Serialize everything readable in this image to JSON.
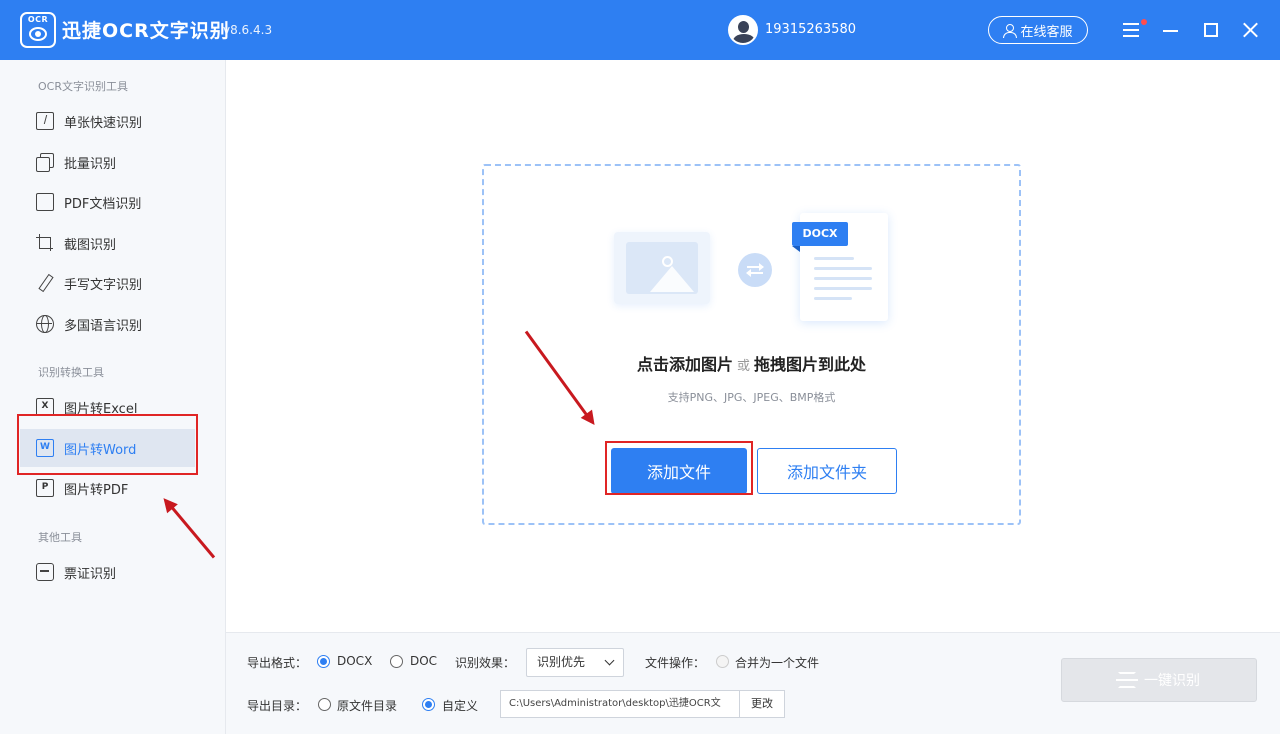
{
  "app": {
    "logo_text": "OCR",
    "name": "迅捷OCR文字识别",
    "version": "v8.6.4.3",
    "phone": "19315263580",
    "service_label": "在线客服"
  },
  "sidebar": {
    "sections": [
      {
        "title": "OCR文字识别工具",
        "items": [
          {
            "label": "单张快速识别",
            "icon": "quick-scan-icon"
          },
          {
            "label": "批量识别",
            "icon": "copy-icon"
          },
          {
            "label": "PDF文档识别",
            "icon": "pdf-doc-icon"
          },
          {
            "label": "截图识别",
            "icon": "crop-icon"
          },
          {
            "label": "手写文字识别",
            "icon": "pen-icon"
          },
          {
            "label": "多国语言识别",
            "icon": "globe-icon"
          }
        ]
      },
      {
        "title": "识别转换工具",
        "items": [
          {
            "label": "图片转Excel",
            "icon": "excel-icon",
            "icon_text": "X"
          },
          {
            "label": "图片转Word",
            "icon": "word-icon",
            "icon_text": "W",
            "active": true
          },
          {
            "label": "图片转PDF",
            "icon": "pdf-icon",
            "icon_text": "P"
          }
        ]
      },
      {
        "title": "其他工具",
        "items": [
          {
            "label": "票证识别",
            "icon": "ticket-scan-icon"
          }
        ]
      }
    ]
  },
  "dropzone": {
    "doc_tag": "DOCX",
    "title_part1": "点击添加图片",
    "title_or": "或",
    "title_part2": "拖拽图片到此处",
    "hint": "支持PNG、JPG、JPEG、BMP格式",
    "add_file_label": "添加文件",
    "add_folder_label": "添加文件夹"
  },
  "bottom": {
    "export_format_label": "导出格式：",
    "format_options": [
      "DOCX",
      "DOC"
    ],
    "format_selected": "DOCX",
    "effect_label": "识别效果：",
    "effect_value": "识别优先",
    "file_op_label": "文件操作：",
    "merge_label": "合并为一个文件",
    "export_dir_label": "导出目录：",
    "dir_options": [
      "原文件目录",
      "自定义"
    ],
    "dir_selected": "自定义",
    "path_value": "C:\\Users\\Administrator\\desktop\\迅捷OCR文",
    "change_label": "更改",
    "start_label": "一键识别"
  },
  "colors": {
    "primary": "#2e7ff2",
    "annotation_red": "#e02525",
    "sidebar_bg": "#f6f8fb"
  }
}
